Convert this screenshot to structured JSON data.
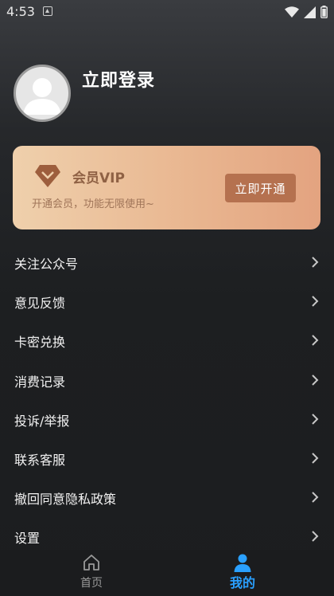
{
  "status_bar": {
    "time": "4:53"
  },
  "profile": {
    "login_label": "立即登录"
  },
  "vip": {
    "title": "会员VIP",
    "subtitle": "开通会员，功能无限使用~",
    "button_label": "立即开通"
  },
  "menu": {
    "items": [
      {
        "label": "关注公众号"
      },
      {
        "label": "意见反馈"
      },
      {
        "label": "卡密兑换"
      },
      {
        "label": "消费记录"
      },
      {
        "label": "投诉/举报"
      },
      {
        "label": "联系客服"
      },
      {
        "label": "撤回同意隐私政策"
      },
      {
        "label": "设置"
      }
    ]
  },
  "tabbar": {
    "home_label": "首页",
    "mine_label": "我的",
    "active_tab": "我的",
    "active_color": "#2aa0ff"
  }
}
